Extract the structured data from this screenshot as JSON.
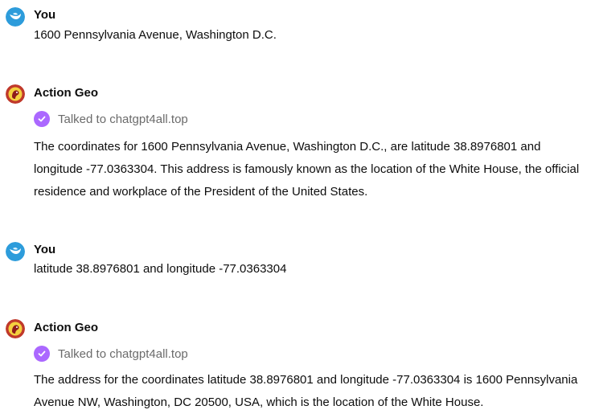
{
  "messages": [
    {
      "author": "You",
      "avatar_icon": "bird-icon",
      "text": "1600 Pennsylvania Avenue, Washington D.C."
    },
    {
      "author": "Action Geo",
      "avatar_icon": "gpt-avatar-icon",
      "tool_status": "Talked to chatgpt4all.top",
      "text": "The coordinates for 1600 Pennsylvania Avenue, Washington D.C., are latitude 38.8976801 and longitude -77.0363304. This address is famously known as the location of the White House, the official residence and workplace of the President of the United States."
    },
    {
      "author": "You",
      "avatar_icon": "bird-icon",
      "text": "latitude 38.8976801 and longitude -77.0363304"
    },
    {
      "author": "Action Geo",
      "avatar_icon": "gpt-avatar-icon",
      "tool_status": "Talked to chatgpt4all.top",
      "text": "The address for the coordinates latitude 38.8976801 and longitude -77.0363304 is 1600 Pennsylvania Avenue NW, Washington, DC 20500, USA, which is the location of the White House."
    }
  ],
  "colors": {
    "user_avatar": "#2d9cdb",
    "bot_avatar": "#c0392b",
    "tool_check": "#ab68ff",
    "tool_text": "#6b6b6b"
  }
}
